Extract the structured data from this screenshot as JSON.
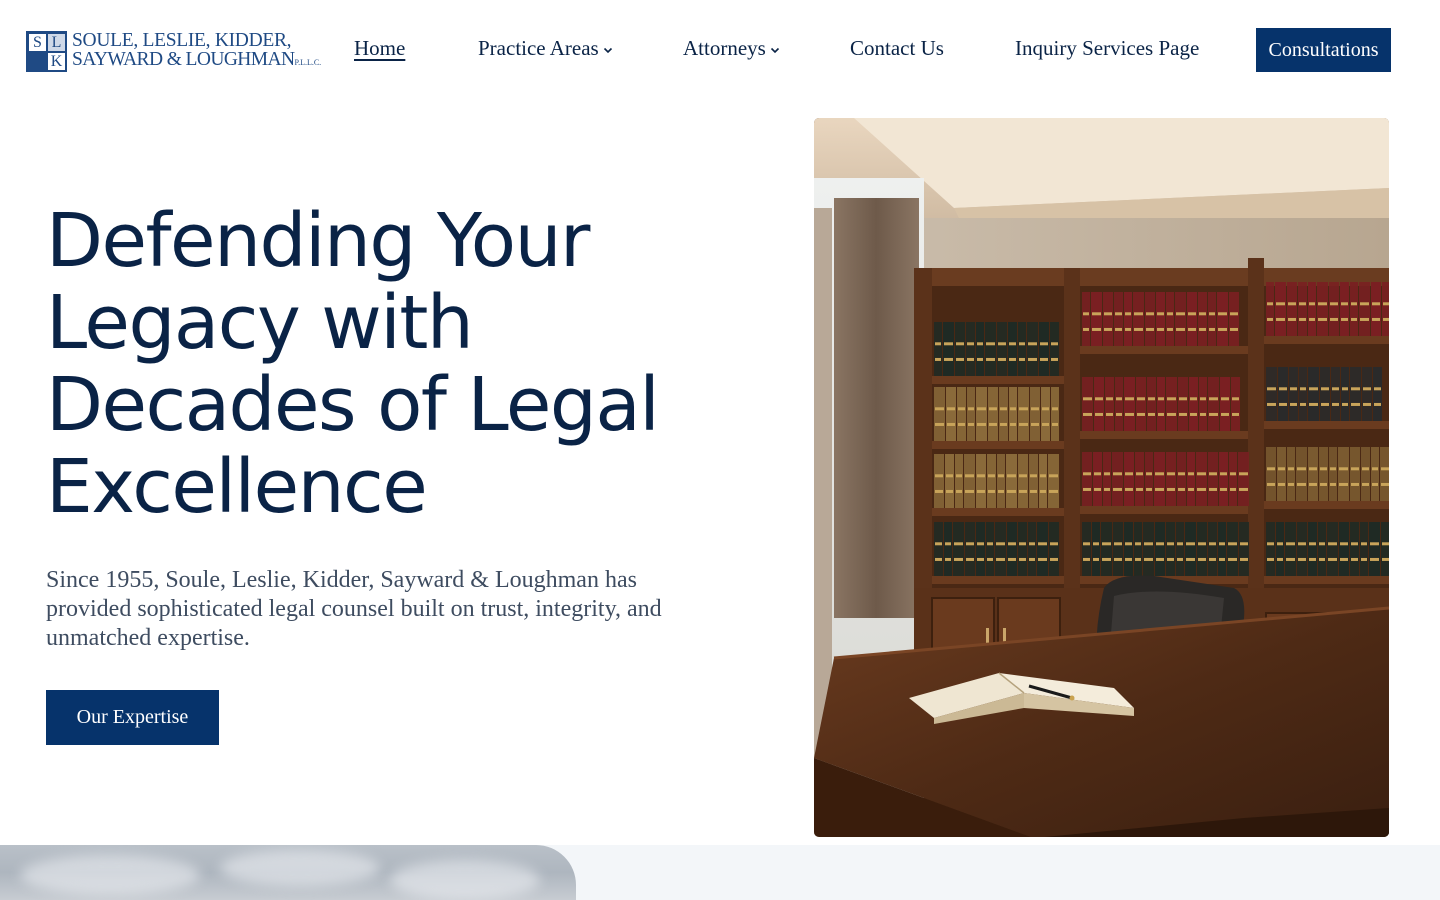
{
  "header": {
    "logo": {
      "monogram": [
        "S",
        "L",
        "K"
      ],
      "line1": "SOULE, LESLIE, KIDDER,",
      "line2": "SAYWARD & LOUGHMAN",
      "suffix": "P.L.L.C."
    },
    "nav": [
      {
        "label": "Home",
        "active": true,
        "has_dropdown": false
      },
      {
        "label": "Practice Areas",
        "active": false,
        "has_dropdown": true
      },
      {
        "label": "Attorneys",
        "active": false,
        "has_dropdown": true
      },
      {
        "label": "Contact Us",
        "active": false,
        "has_dropdown": false
      },
      {
        "label": "Inquiry Services Page",
        "active": false,
        "has_dropdown": false
      }
    ],
    "cta_label": "Consultations"
  },
  "hero": {
    "title_lines": [
      "Defending Your",
      "Legacy with",
      "Decades of Legal",
      "Excellence"
    ],
    "description": "Since 1955, Soule, Leslie, Kidder, Sayward & Loughman has provided sophisticated legal counsel built on trust, integrity, and unmatched expertise.",
    "button_label": "Our Expertise"
  },
  "colors": {
    "navy": "#0a2346",
    "button": "#06336b",
    "logo_blue": "#1f4a84",
    "body_text": "#3e4c60",
    "band": "#f3f6f9"
  },
  "icons": {
    "dropdown": "chevron-down-icon"
  }
}
